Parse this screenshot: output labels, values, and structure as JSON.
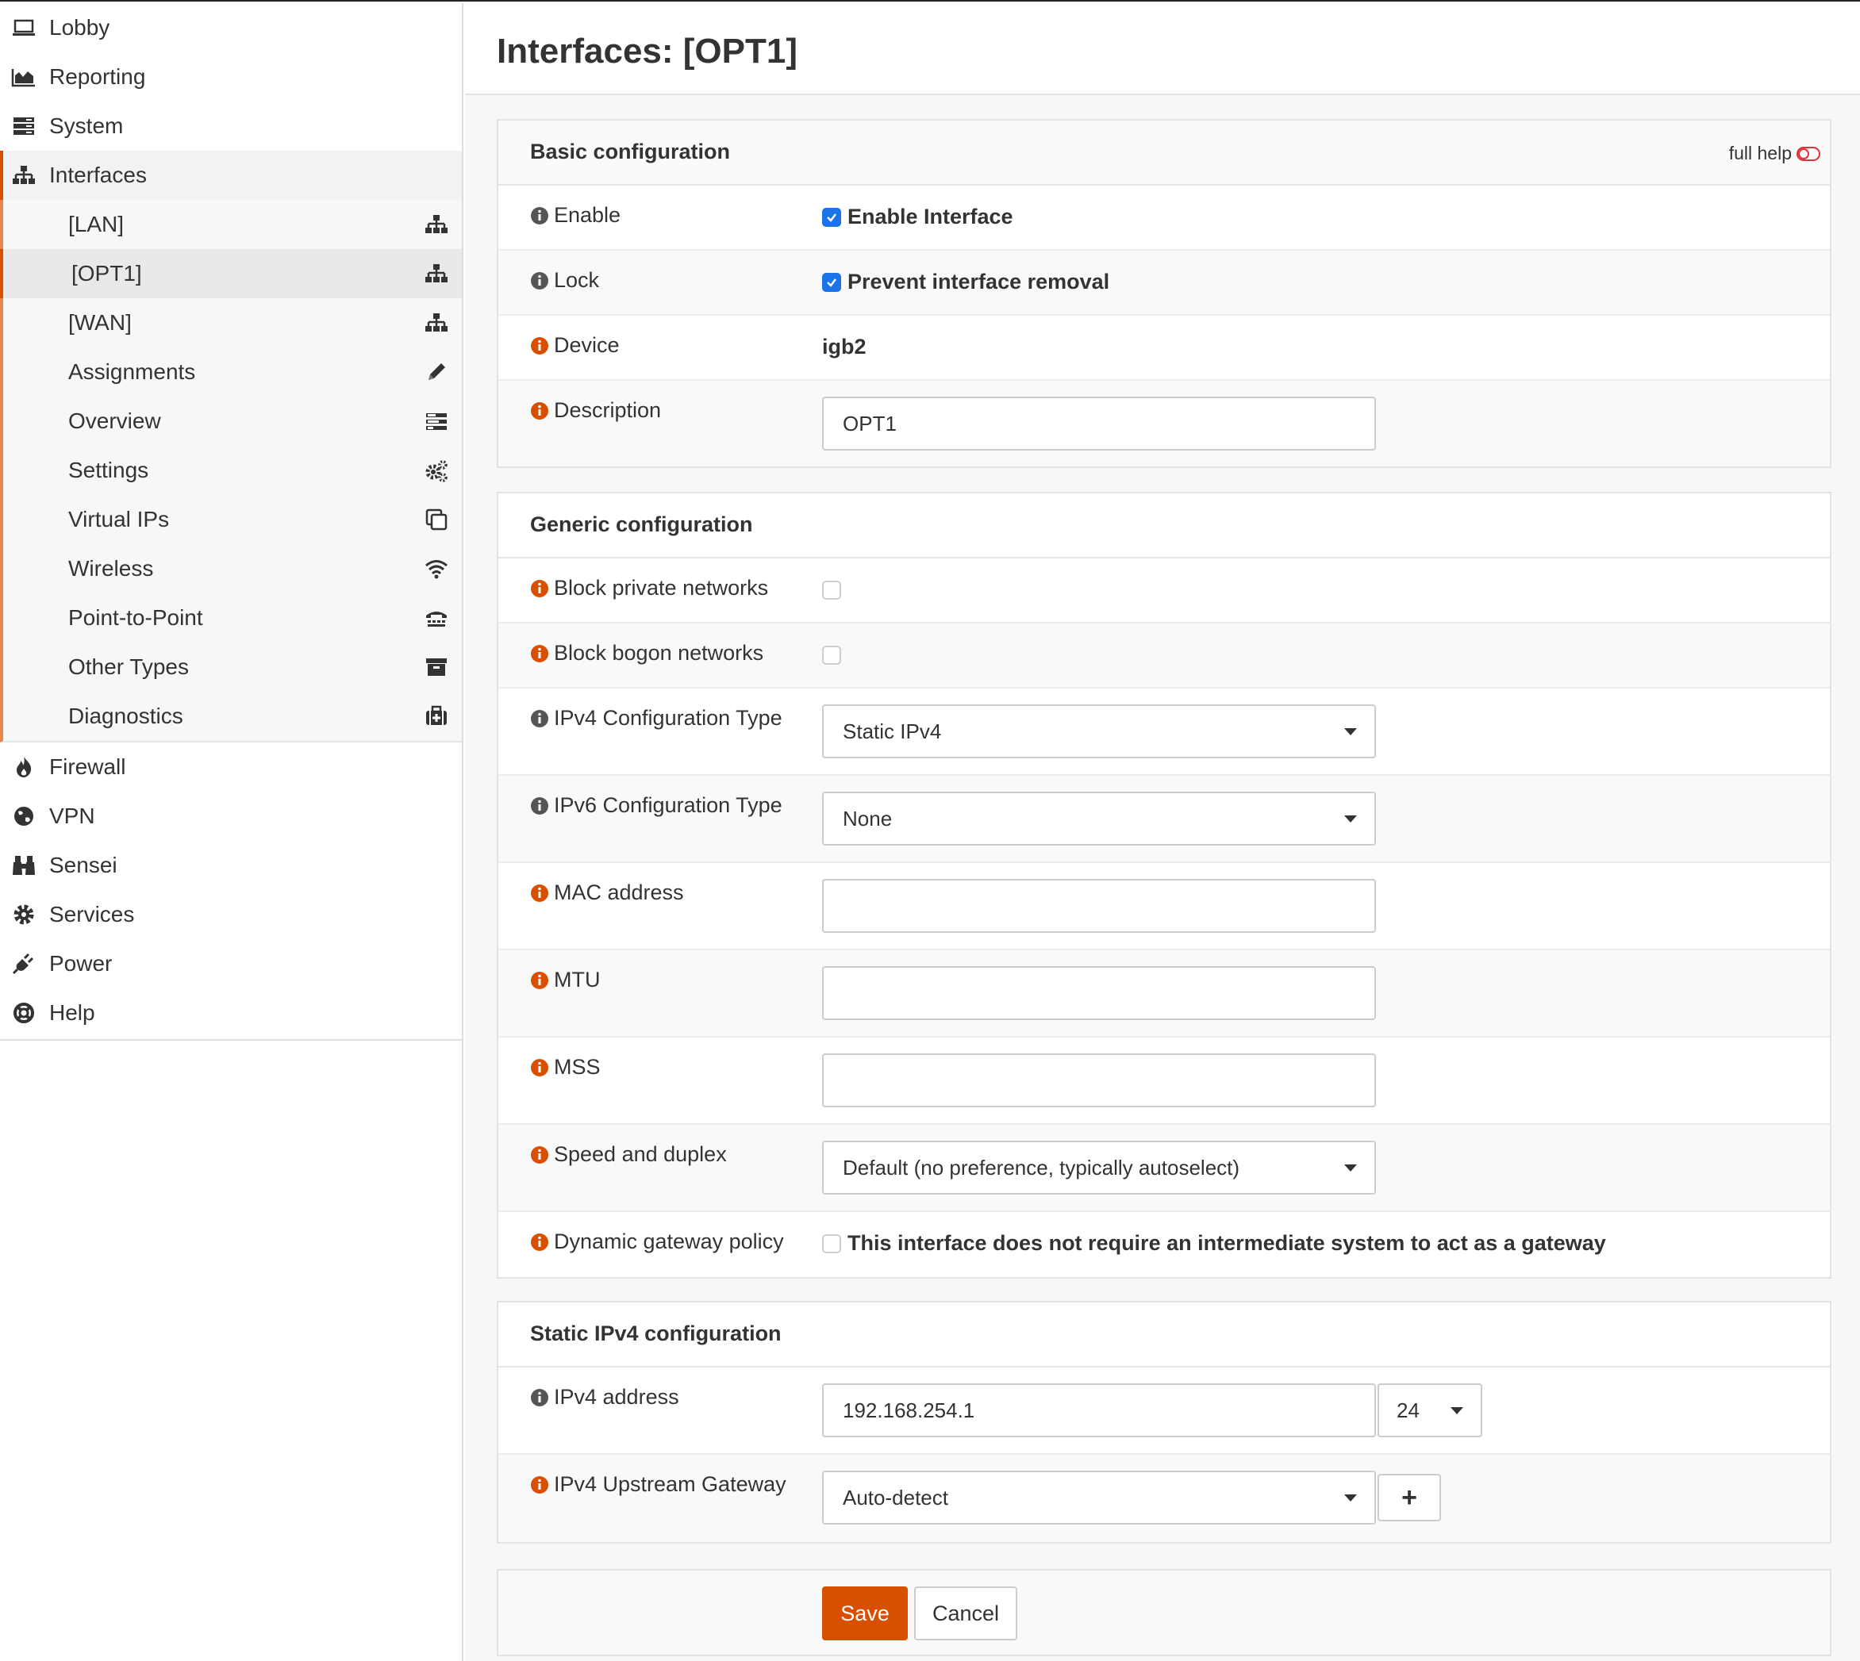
{
  "sidebar": {
    "top_items": [
      {
        "label": "Lobby",
        "icon": "laptop-icon"
      },
      {
        "label": "Reporting",
        "icon": "area-chart-icon"
      },
      {
        "label": "System",
        "icon": "server-icon"
      },
      {
        "label": "Interfaces",
        "icon": "sitemap-icon"
      }
    ],
    "interfaces_sub": [
      {
        "label": "[LAN]",
        "icon": "sitemap-icon"
      },
      {
        "label": "[OPT1]",
        "icon": "sitemap-icon"
      },
      {
        "label": "[WAN]",
        "icon": "sitemap-icon"
      },
      {
        "label": "Assignments",
        "icon": "pencil-icon"
      },
      {
        "label": "Overview",
        "icon": "tasks-icon"
      },
      {
        "label": "Settings",
        "icon": "cogs-icon"
      },
      {
        "label": "Virtual IPs",
        "icon": "clone-icon"
      },
      {
        "label": "Wireless",
        "icon": "wifi-icon"
      },
      {
        "label": "Point-to-Point",
        "icon": "tty-icon"
      },
      {
        "label": "Other Types",
        "icon": "archive-icon"
      },
      {
        "label": "Diagnostics",
        "icon": "medkit-icon"
      }
    ],
    "bottom_items": [
      {
        "label": "Firewall",
        "icon": "fire-icon"
      },
      {
        "label": "VPN",
        "icon": "globe-icon"
      },
      {
        "label": "Sensei",
        "icon": "binoculars-icon"
      },
      {
        "label": "Services",
        "icon": "gear-icon"
      },
      {
        "label": "Power",
        "icon": "plug-icon"
      },
      {
        "label": "Help",
        "icon": "life-ring-icon"
      }
    ]
  },
  "page": {
    "title": "Interfaces: [OPT1]"
  },
  "basic": {
    "title": "Basic configuration",
    "full_help": "full help",
    "enable_label": "Enable",
    "enable_text": "Enable Interface",
    "lock_label": "Lock",
    "lock_text": "Prevent interface removal",
    "device_label": "Device",
    "device_value": "igb2",
    "description_label": "Description",
    "description_value": "OPT1"
  },
  "generic": {
    "title": "Generic configuration",
    "block_private_label": "Block private networks",
    "block_bogon_label": "Block bogon networks",
    "ipv4_type_label": "IPv4 Configuration Type",
    "ipv4_type_value": "Static IPv4",
    "ipv6_type_label": "IPv6 Configuration Type",
    "ipv6_type_value": "None",
    "mac_label": "MAC address",
    "mac_value": "",
    "mtu_label": "MTU",
    "mtu_value": "",
    "mss_label": "MSS",
    "mss_value": "",
    "speed_label": "Speed and duplex",
    "speed_value": "Default (no preference, typically autoselect)",
    "dyn_gw_label": "Dynamic gateway policy",
    "dyn_gw_text": "This interface does not require an intermediate system to act as a gateway"
  },
  "static4": {
    "title": "Static IPv4 configuration",
    "address_label": "IPv4 address",
    "address_value": "192.168.254.1",
    "prefix_value": "24",
    "gateway_label": "IPv4 Upstream Gateway",
    "gateway_value": "Auto-detect",
    "add_gateway_symbol": "+"
  },
  "actions": {
    "save": "Save",
    "cancel": "Cancel"
  },
  "colors": {
    "accent": "#d94f00",
    "accent_light": "#e8854a",
    "checkbox": "#1a73e8",
    "info_orange": "#d94f00",
    "info_gray": "#555555"
  }
}
